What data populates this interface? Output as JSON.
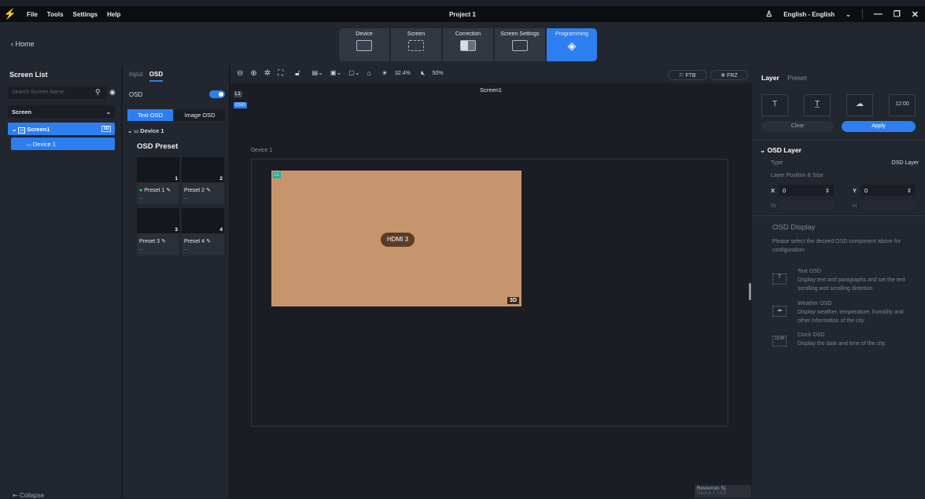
{
  "titlebar": {
    "menu": [
      "File",
      "Tools",
      "Settings",
      "Help"
    ],
    "project": "Project 1",
    "language": "English - English"
  },
  "nav": {
    "home": "Home",
    "tabs": [
      "Device",
      "Screen",
      "Correction",
      "Screen Settings",
      "Programming"
    ]
  },
  "screen_list": {
    "title": "Screen List",
    "search_placeholder": "Search Screen Name",
    "select_value": "Screen",
    "screen_item": "Screen1",
    "screen_badge": "3D",
    "device_item": "Device 1",
    "collapse": "Collapse"
  },
  "osd_panel": {
    "tab_input": "Input",
    "tab_osd": "OSD",
    "osd_label": "OSD",
    "text_osd": "Text OSD",
    "image_osd": "Image OSD",
    "device": "Device 1",
    "preset_title": "OSD Preset",
    "presets": [
      {
        "num": "1",
        "label": "Preset 1",
        "sub": "--"
      },
      {
        "num": "2",
        "label": "Preset 2",
        "sub": "--"
      },
      {
        "num": "3",
        "label": "Preset 3",
        "sub": "--"
      },
      {
        "num": "4",
        "label": "Preset 4",
        "sub": "--"
      }
    ]
  },
  "canvas": {
    "brightness": "32.4%",
    "volume": "50%",
    "ftb": "FTB",
    "frz": "FRZ",
    "chip_l1": "L1",
    "chip_osd": "OSD",
    "screen_name": "Screen1",
    "device_name": "Device 1",
    "layer_chip": "L1",
    "hdmi": "HDMI 3",
    "badge_3d": "3D",
    "resources": "Resources SL",
    "resources2": "Device 1    1/12"
  },
  "right_panel": {
    "tab_layer": "Layer",
    "tab_preset": "Preset",
    "clear": "Clear",
    "apply": "Apply",
    "osd_layer": "OSD Layer",
    "type_label": "Type",
    "type_value": "OSD Layer",
    "pos_size": "Layer Position & Size",
    "x_label": "X",
    "x_value": "0",
    "y_label": "Y",
    "y_value": "0",
    "w_label": "W",
    "h_label": "H",
    "display_title": "OSD Display",
    "display_desc": "Please select the desired OSD component above for configuration.",
    "items": [
      {
        "title": "Text OSD",
        "desc": "Display text and paragraphs and set the text scrolling and scrolling direction."
      },
      {
        "title": "Weather OSD",
        "desc": "Display weather, temperature, humidity and other information of the city."
      },
      {
        "title": "Clock OSD",
        "desc": "Display the date and time of the city."
      }
    ],
    "clock_icon_text": "12:00"
  }
}
